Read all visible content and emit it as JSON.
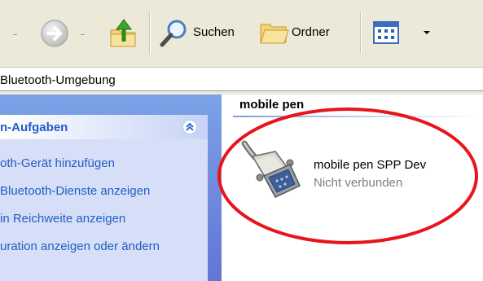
{
  "toolbar": {
    "search_label": "Suchen",
    "folders_label": "Ordner"
  },
  "address": {
    "value": "Bluetooth-Umgebung"
  },
  "tasks": {
    "title": "n-Aufgaben",
    "collapse_glyph": "⌃",
    "links": [
      "oth-Gerät hinzufügen",
      "Bluetooth-Dienste anzeigen",
      " in Reichweite anzeigen",
      "uration anzeigen oder ändern"
    ]
  },
  "content": {
    "group_title": "mobile pen",
    "device": {
      "name": "mobile pen SPP Dev",
      "status": "Nicht verbunden",
      "icon": "serial-cable-icon"
    }
  },
  "colors": {
    "pane_gradient_top": "#7ba2e7",
    "pane_gradient_bottom": "#6375d6",
    "task_link": "#215dc6",
    "highlight_ellipse": "#e8141c"
  }
}
